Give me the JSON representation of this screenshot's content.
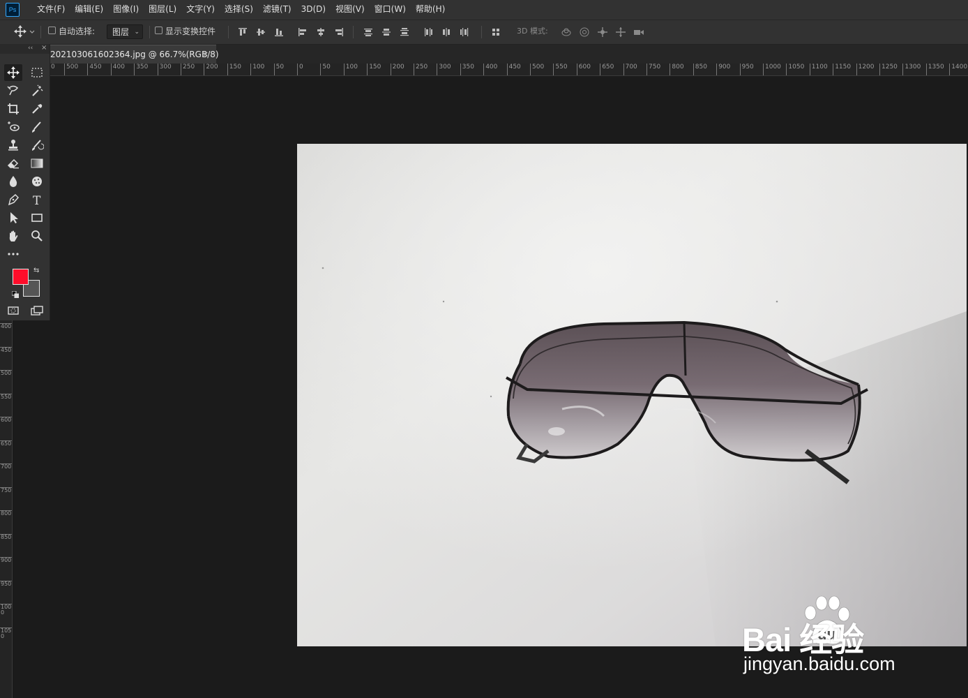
{
  "app": {
    "logo_text": "Ps"
  },
  "menu": [
    {
      "label": "文件(F)"
    },
    {
      "label": "编辑(E)"
    },
    {
      "label": "图像(I)"
    },
    {
      "label": "图层(L)"
    },
    {
      "label": "文字(Y)"
    },
    {
      "label": "选择(S)"
    },
    {
      "label": "滤镜(T)"
    },
    {
      "label": "3D(D)"
    },
    {
      "label": "视图(V)"
    },
    {
      "label": "窗口(W)"
    },
    {
      "label": "帮助(H)"
    }
  ],
  "options": {
    "auto_select_label": "自动选择:",
    "auto_select_checked": false,
    "auto_select_target": "图层",
    "show_transform_label": "显示变换控件",
    "show_transform_checked": false,
    "mode_3d_label": "3D 模式:"
  },
  "document": {
    "tab_title": "202103061602364.jpg @ 66.7%(RGB/8)",
    "close_glyph": "×"
  },
  "rulers": {
    "horizontal": [
      "0",
      "500",
      "450",
      "400",
      "350",
      "300",
      "250",
      "200",
      "150",
      "100",
      "50",
      "0",
      "50",
      "100",
      "150",
      "200",
      "250",
      "300",
      "350",
      "400",
      "450",
      "500",
      "550",
      "600",
      "650",
      "700",
      "750",
      "800",
      "850",
      "900",
      "950",
      "1000",
      "1050",
      "1100",
      "1150",
      "1200",
      "1250",
      "1300",
      "1350",
      "1400"
    ],
    "vertical": [
      "400",
      "450",
      "500",
      "550",
      "600",
      "650",
      "700",
      "750",
      "800",
      "850",
      "900",
      "950",
      "1000",
      "1050"
    ]
  },
  "toolbox": {
    "collapse_glyph": "‹‹",
    "close_glyph": "×",
    "foreground_color": "#fe0d2a",
    "background_color": "#555555",
    "tools": [
      "move-tool-icon",
      "rectangular-marquee-icon",
      "lasso-icon",
      "magic-wand-icon",
      "crop-icon",
      "eyedropper-icon",
      "spot-healing-icon",
      "brush-icon",
      "clone-stamp-icon",
      "history-brush-icon",
      "eraser-icon",
      "gradient-icon",
      "blur-icon",
      "sponge-icon",
      "pen-icon",
      "type-icon",
      "path-selection-icon",
      "rectangle-shape-icon",
      "hand-icon",
      "zoom-icon",
      "more-tools-icon"
    ],
    "type_tool_glyph": "T",
    "more_glyph": "•••"
  },
  "watermark": {
    "brand": "Bai  经验",
    "url": "jingyan.baidu.com"
  }
}
